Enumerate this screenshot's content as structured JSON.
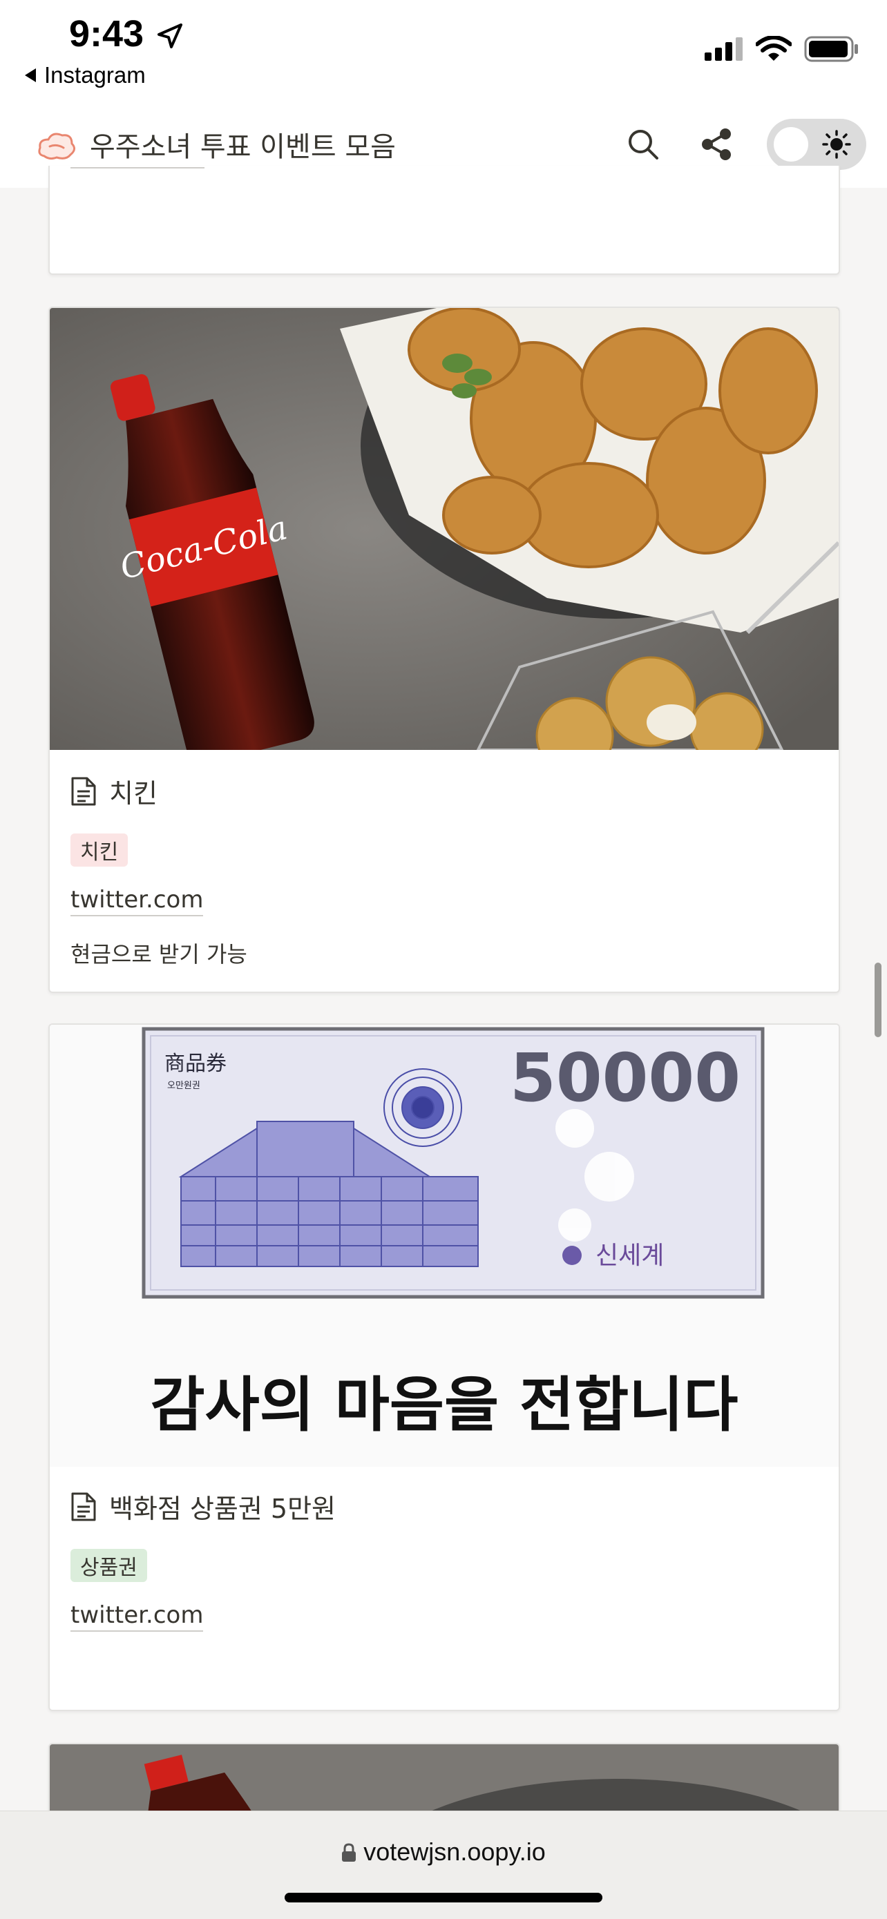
{
  "status_bar": {
    "time": "9:43",
    "back_label": "Instagram"
  },
  "header": {
    "title": "우주소녀 투표 이벤트 모음",
    "icons": [
      "cloud-logo-icon",
      "search-icon",
      "share-icon",
      "sun-icon"
    ],
    "theme_toggle": "light"
  },
  "cards": [
    {
      "title": "치킨",
      "tag": "치킨",
      "tag_color": "#fbe4e4",
      "link": "twitter.com",
      "description": "현금으로 받기 가능"
    },
    {
      "title": "백화점 상품권 5만원",
      "tag": "상품권",
      "tag_color": "#dbeddb",
      "link": "twitter.com",
      "voucher": {
        "label": "商品券",
        "sub_label": "오만원권",
        "amount": "50000",
        "brand": "신세계",
        "caption": "감사의 마음을 전합니다"
      }
    }
  ],
  "url_bar": {
    "url": "votewjsn.oopy.io"
  }
}
